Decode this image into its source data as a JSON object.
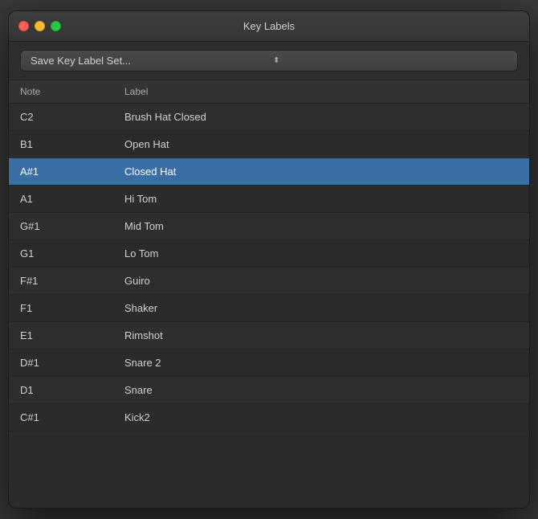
{
  "window": {
    "title": "Key Labels"
  },
  "toolbar": {
    "dropdown_label": "Save Key Label Set...",
    "dropdown_arrow": "⌃"
  },
  "table": {
    "headers": [
      {
        "id": "note",
        "label": "Note"
      },
      {
        "id": "label",
        "label": "Label"
      }
    ],
    "rows": [
      {
        "note": "C2",
        "label": "Brush Hat Closed",
        "selected": false
      },
      {
        "note": "B1",
        "label": "Open Hat",
        "selected": false
      },
      {
        "note": "A#1",
        "label": "Closed Hat",
        "selected": true
      },
      {
        "note": "A1",
        "label": "Hi Tom",
        "selected": false
      },
      {
        "note": "G#1",
        "label": "Mid Tom",
        "selected": false
      },
      {
        "note": "G1",
        "label": "Lo Tom",
        "selected": false
      },
      {
        "note": "F#1",
        "label": "Guiro",
        "selected": false
      },
      {
        "note": "F1",
        "label": "Shaker",
        "selected": false
      },
      {
        "note": "E1",
        "label": "Rimshot",
        "selected": false
      },
      {
        "note": "D#1",
        "label": "Snare 2",
        "selected": false
      },
      {
        "note": "D1",
        "label": "Snare",
        "selected": false
      },
      {
        "note": "C#1",
        "label": "Kick2",
        "selected": false
      }
    ]
  }
}
